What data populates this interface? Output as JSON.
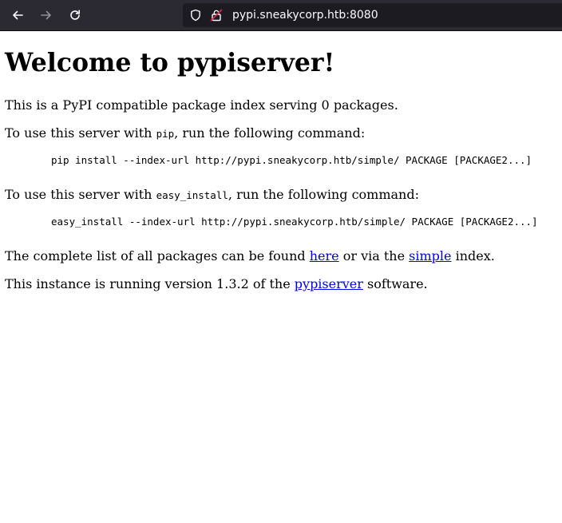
{
  "browser": {
    "url": "pypi.sneakycorp.htb:8080",
    "icons": {
      "back": "arrow-left-icon",
      "forward": "arrow-right-icon",
      "reload": "reload-icon",
      "shield": "shield-icon",
      "lock": "insecure-lock-icon"
    }
  },
  "page": {
    "title": "Welcome to pypiserver!",
    "intro": "This is a PyPI compatible package index serving 0 packages.",
    "pip_prefix": "To use this server with ",
    "pip_code": "pip",
    "pip_suffix": ", run the following command:",
    "pip_command": "pip install --index-url http://pypi.sneakycorp.htb/simple/ PACKAGE [PACKAGE2...]",
    "easy_prefix": "To use this server with ",
    "easy_code": "easy_install",
    "easy_suffix": ", run the following command:",
    "easy_command": "easy_install --index-url http://pypi.sneakycorp.htb/simple/ PACKAGE [PACKAGE2...]",
    "list_prefix": "The complete list of all packages can be found ",
    "list_link_here": "here",
    "list_middle": " or via the ",
    "list_link_simple": "simple",
    "list_suffix": " index.",
    "version_prefix": "This instance is running version 1.3.2 of the ",
    "version_link": "pypiserver",
    "version_suffix": " software."
  },
  "colors": {
    "toolbar_bg": "#2b2a33",
    "urlbar_bg": "#1c1b22",
    "link": "#0000ee"
  }
}
